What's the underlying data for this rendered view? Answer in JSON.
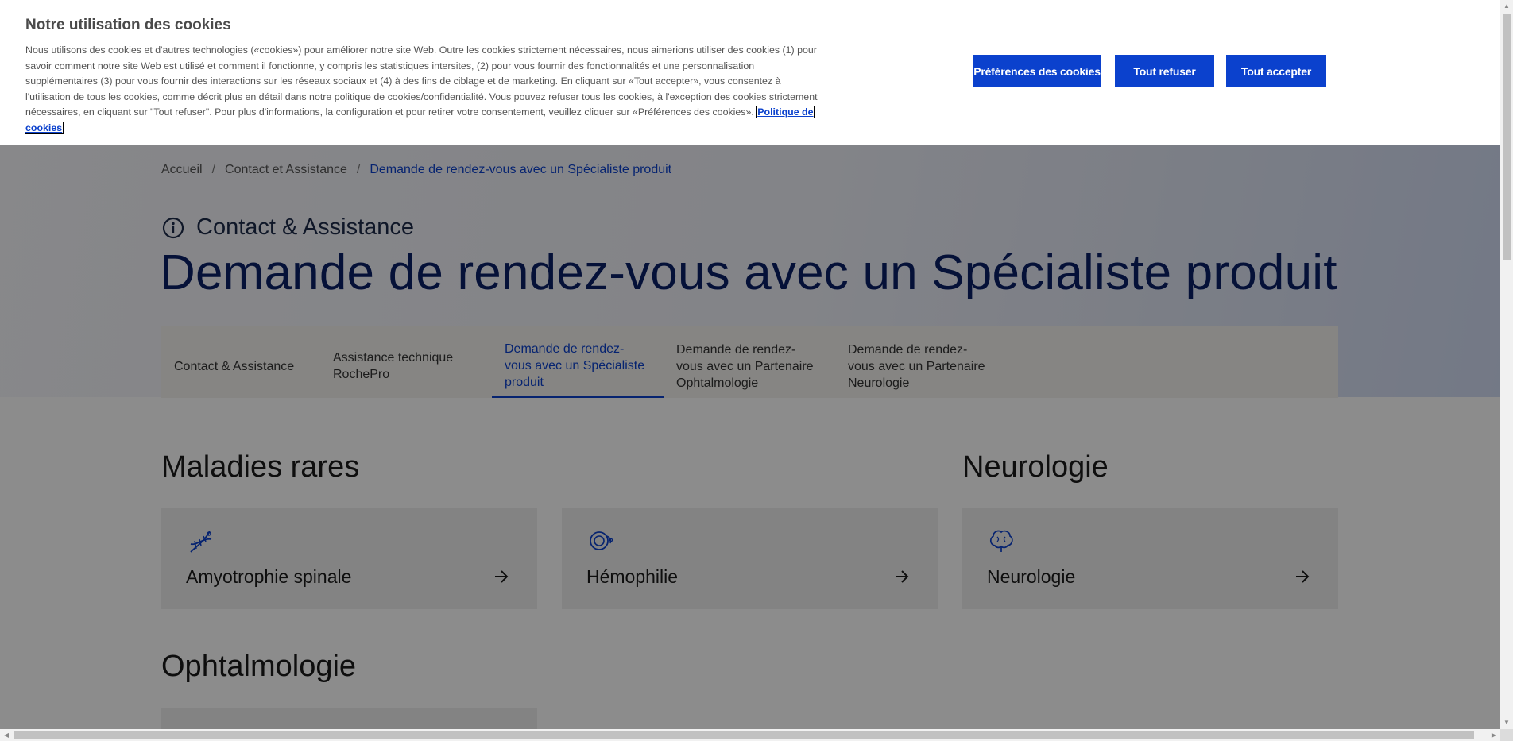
{
  "cookie_banner": {
    "title": "Notre utilisation des cookies",
    "text": "Nous utilisons des cookies et d'autres technologies («cookies») pour améliorer notre site Web. Outre les cookies strictement nécessaires, nous aimerions utiliser des cookies (1) pour savoir comment notre site Web est utilisé et comment il fonctionne, y compris les statistiques intersites, (2) pour vous fournir des fonctionnalités et une personnalisation supplémentaires (3) pour vous fournir des interactions sur les réseaux sociaux et (4) à des fins de ciblage et de marketing. En cliquant sur «Tout accepter», vous consentez à l'utilisation de tous les cookies, comme décrit plus en détail dans notre politique de cookies/confidentialité. Vous pouvez refuser tous les cookies, à l'exception des cookies strictement nécessaires, en cliquant sur \"Tout refuser\". Pour plus d'informations, la configuration et pour retirer votre consentement, veuillez cliquer sur «Préférences des cookies».",
    "policy_link": "Politique de cookies",
    "buttons": {
      "preferences": "Préférences des cookies",
      "refuse": "Tout refuser",
      "accept": "Tout accepter"
    }
  },
  "breadcrumb": {
    "items": [
      "Accueil",
      "Contact et Assistance",
      "Demande de rendez-vous avec un Spécialiste produit"
    ],
    "separator": "/"
  },
  "section_title": "Contact & Assistance",
  "page_title": "Demande de rendez-vous avec un Spécialiste produit",
  "tabs": [
    {
      "label": "Contact & Assistance"
    },
    {
      "label": "Assistance technique RochePro"
    },
    {
      "label": "Demande de rendez-vous avec un Spécialiste produit"
    },
    {
      "label": "Demande de rendez-vous avec un Partenaire Ophtalmologie"
    },
    {
      "label": "Demande de rendez-vous avec un Partenaire Neurologie"
    }
  ],
  "categories": {
    "rare_diseases": {
      "title": "Maladies rares",
      "cards": [
        {
          "label": "Amyotrophie spinale",
          "icon": "dna-icon"
        },
        {
          "label": "Hémophilie",
          "icon": "blood-cell-icon"
        }
      ]
    },
    "neurology": {
      "title": "Neurologie",
      "cards": [
        {
          "label": "Neurologie",
          "icon": "brain-icon"
        }
      ]
    },
    "ophthalmology": {
      "title": "Ophtalmologie"
    }
  },
  "colors": {
    "accent": "#0b41cd",
    "title": "#0a1f66"
  }
}
